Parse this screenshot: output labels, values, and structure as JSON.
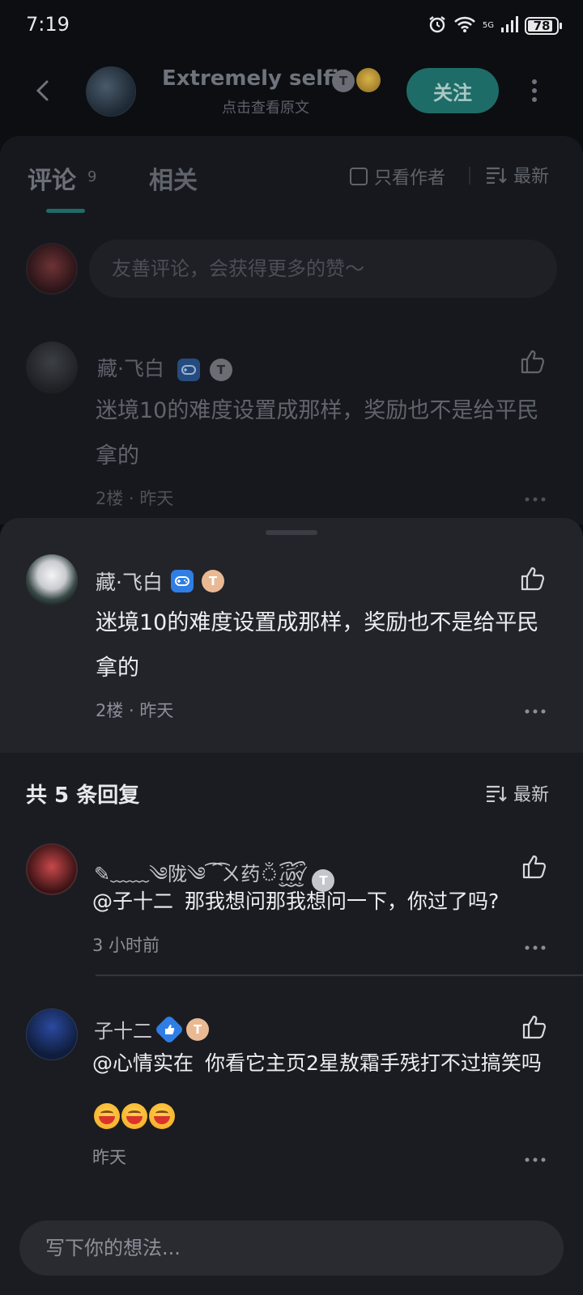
{
  "status": {
    "time": "7:19",
    "battery": "78",
    "network": "5G"
  },
  "nav": {
    "author_name": "Extremely selfi",
    "author_sub": "点击查看原文",
    "follow_label": "关注"
  },
  "tabs": {
    "comments_label": "评论",
    "comments_count": "9",
    "related_label": "相关",
    "author_only_label": "只看作者",
    "sort_label": "最新"
  },
  "comment_input": {
    "placeholder": "友善评论，会获得更多的赞～"
  },
  "main_comment": {
    "user": "藏·飞白",
    "level": "T",
    "text": "迷境10的难度设置成那样，奖励也不是给平民拿的",
    "floor": "2楼",
    "time": "昨天"
  },
  "replies": {
    "title": "共 5 条回复",
    "sort_label": "最新",
    "items": [
      {
        "user": "✎﹏﹏༄陇༄⁀͡ㄨ药ঁ꫞",
        "level": "T",
        "mention": "@子十二",
        "text": "那我想问那我想问一下，你过了吗?",
        "time": "3 小时前"
      },
      {
        "user": "子十二",
        "level": "T",
        "mention": "@心情实在",
        "text": "你看它主页2星敖霜手残打不过搞笑吗",
        "time": "昨天"
      }
    ]
  },
  "reply_input": {
    "placeholder": "写下你的想法..."
  },
  "colors": {
    "accent": "#1e6c67",
    "badge_blue": "#2f7ee6",
    "badge_peach": "#e9b994"
  }
}
